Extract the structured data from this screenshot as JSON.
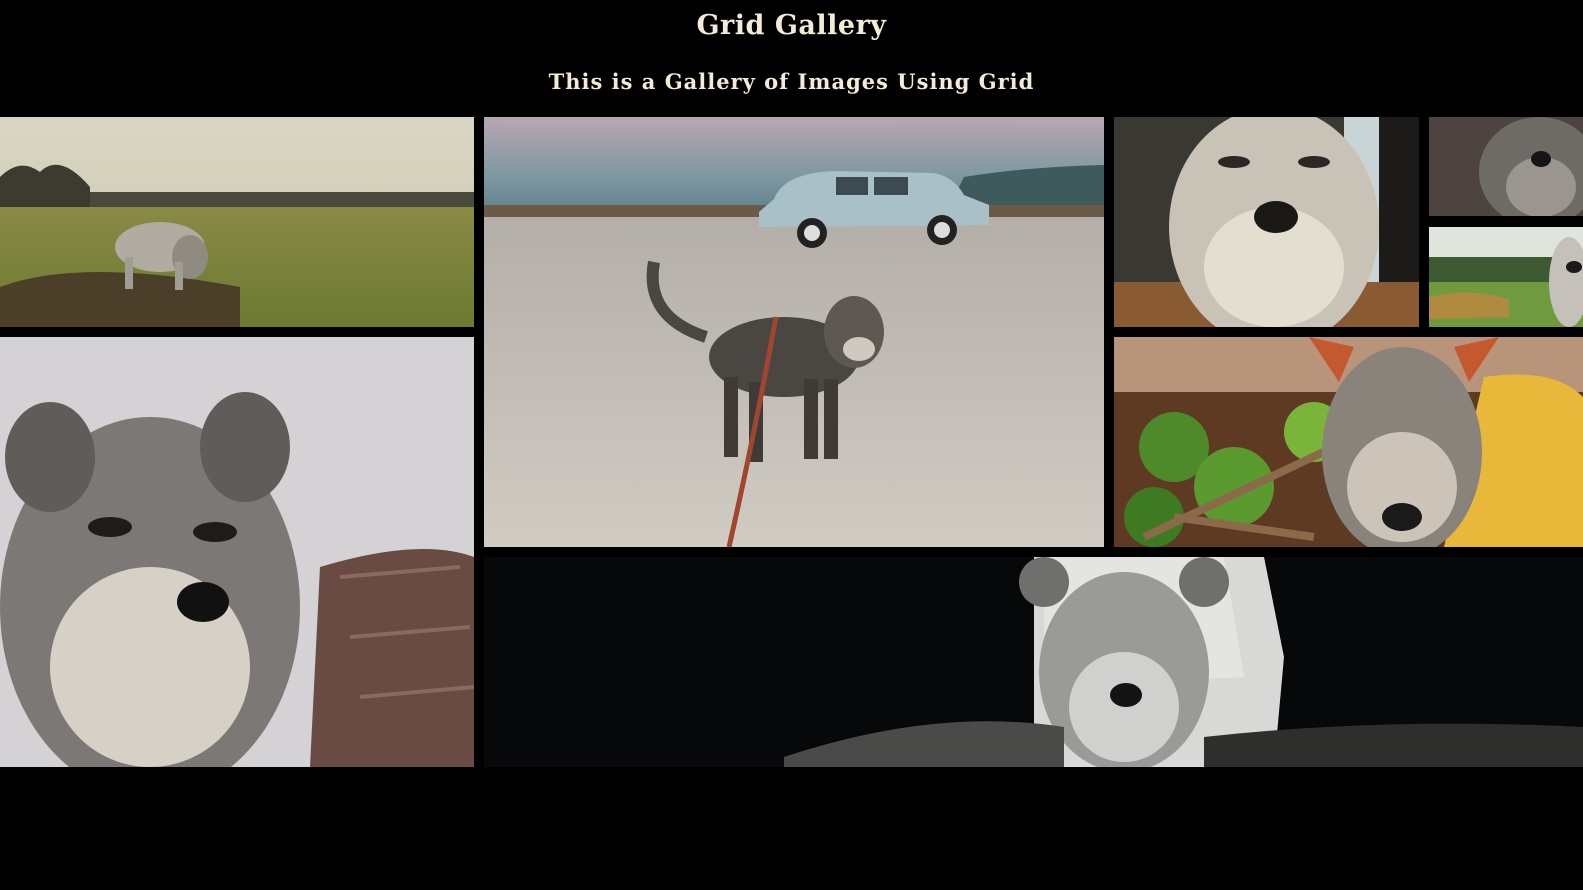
{
  "header": {
    "title": "Grid Gallery",
    "subtitle": "This is a Gallery of Images Using Grid"
  },
  "gallery": {
    "images": [
      {
        "subject": "dog-in-field"
      },
      {
        "subject": "dog-on-leash-with-car"
      },
      {
        "subject": "dog-face-closeup"
      },
      {
        "subject": "dog-face-small"
      },
      {
        "subject": "dog-on-lawn"
      },
      {
        "subject": "dog-on-couch"
      },
      {
        "subject": "dog-with-yellow-hoodie"
      },
      {
        "subject": "dog-black-and-white"
      }
    ]
  },
  "colors": {
    "background": "#000000",
    "text": "#f4ead8"
  }
}
